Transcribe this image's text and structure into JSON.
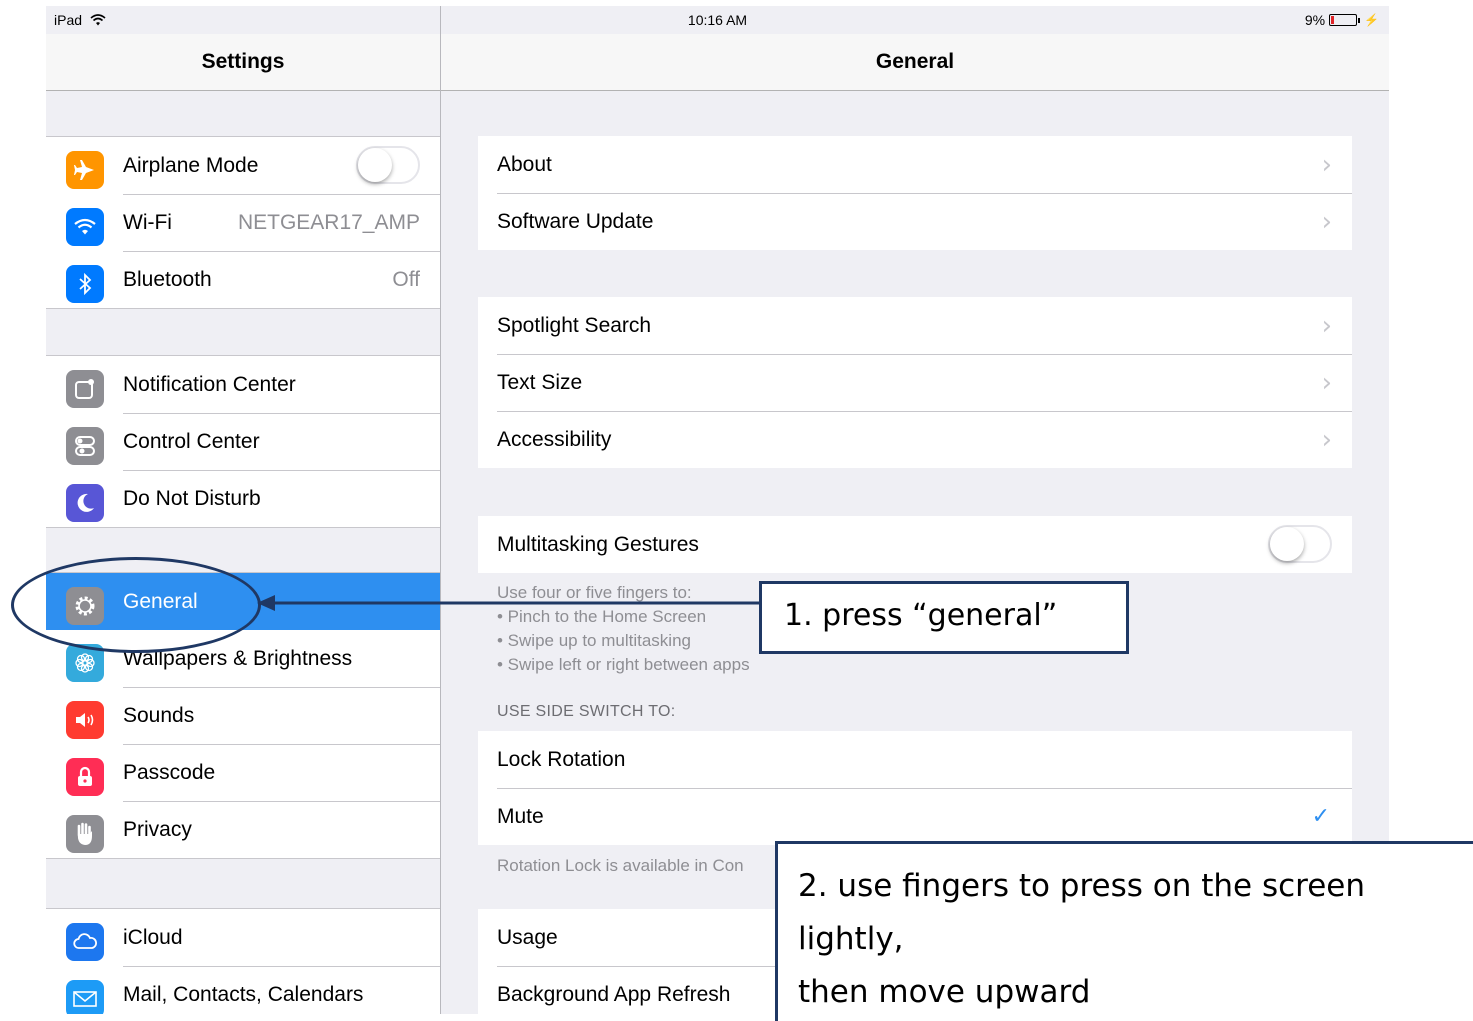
{
  "status_bar": {
    "device": "iPad",
    "time": "10:16 AM",
    "battery": "9%"
  },
  "left_panel": {
    "title": "Settings",
    "groups": [
      {
        "items": [
          {
            "label": "Airplane Mode",
            "icon": "airplane-icon",
            "color": "#ff9500",
            "toggle": "off"
          },
          {
            "label": "Wi-Fi",
            "value": "NETGEAR17_AMP",
            "icon": "wifi-icon",
            "color": "#007aff"
          },
          {
            "label": "Bluetooth",
            "value": "Off",
            "icon": "bluetooth-icon",
            "color": "#007aff"
          }
        ]
      },
      {
        "items": [
          {
            "label": "Notification Center",
            "icon": "notification-icon",
            "color": "#8e8e93"
          },
          {
            "label": "Control Center",
            "icon": "control-center-icon",
            "color": "#8e8e93"
          },
          {
            "label": "Do Not Disturb",
            "icon": "moon-icon",
            "color": "#5856d6"
          }
        ]
      },
      {
        "items": [
          {
            "label": "General",
            "icon": "gear-icon",
            "color": "#8e8e93",
            "selected": true
          },
          {
            "label": "Wallpapers & Brightness",
            "icon": "flower-icon",
            "color": "#34aadc"
          },
          {
            "label": "Sounds",
            "icon": "speaker-icon",
            "color": "#ff3b30"
          },
          {
            "label": "Passcode",
            "icon": "lock-icon",
            "color": "#ff2d55"
          },
          {
            "label": "Privacy",
            "icon": "hand-icon",
            "color": "#8e8e93"
          }
        ]
      },
      {
        "items": [
          {
            "label": "iCloud",
            "icon": "cloud-icon",
            "color": "#1d77ef"
          },
          {
            "label": "Mail, Contacts, Calendars",
            "icon": "mail-icon",
            "color": "#1d9bf6"
          }
        ]
      }
    ]
  },
  "right_panel": {
    "title": "General",
    "group1": [
      "About",
      "Software Update"
    ],
    "group2": [
      "Spotlight Search",
      "Text Size",
      "Accessibility"
    ],
    "multitasking": {
      "label": "Multitasking Gestures",
      "toggle": "off"
    },
    "multitasking_footer": [
      "Use four or five fingers to:",
      "• Pinch to the Home Screen",
      "• Swipe up to multitasking",
      "• Swipe left or right between apps"
    ],
    "side_switch_header": "USE SIDE SWITCH TO:",
    "side_switch_options": [
      "Lock Rotation",
      "Mute"
    ],
    "side_switch_selected": "Mute",
    "side_switch_footer": "Rotation Lock is available in Con",
    "group4": [
      "Usage",
      "Background App Refresh"
    ]
  },
  "annotations": {
    "step1": "1. press “general”",
    "step2_line1": "2. use fingers to press on the screen lightly,",
    "step2_line2": "then move upward",
    "color": "#1f3864"
  }
}
